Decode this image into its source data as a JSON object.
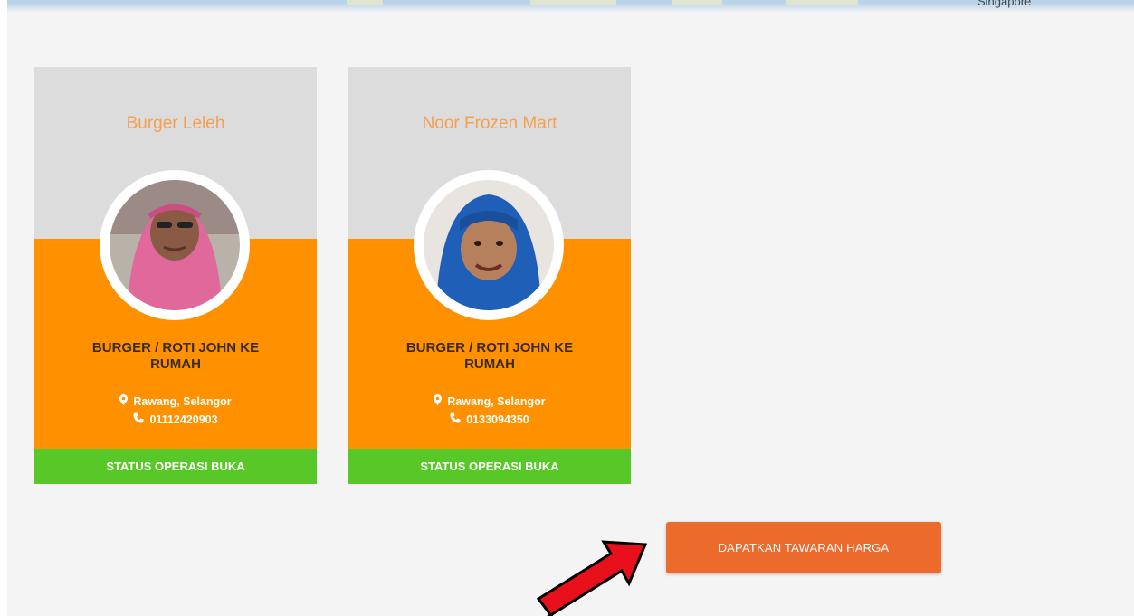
{
  "map": {
    "label": "Singapore"
  },
  "cards": [
    {
      "title": "Burger Leleh",
      "category": "BURGER / ROTI JOHN KE RUMAH",
      "location": "Rawang, Selangor",
      "phone": "01112420903",
      "status": "STATUS OPERASI BUKA",
      "avatar_colors": {
        "bg": "#b9b2a8",
        "hijab": "#e0689a",
        "skin": "#8a5a44"
      }
    },
    {
      "title": "Noor Frozen Mart",
      "category": "BURGER / ROTI JOHN KE RUMAH",
      "location": "Rawang, Selangor",
      "phone": "0133094350",
      "status": "STATUS OPERASI BUKA",
      "avatar_colors": {
        "bg": "#e8e4df",
        "hijab": "#1f5fb8",
        "skin": "#b7805c"
      }
    }
  ],
  "cta": {
    "label": "DAPATKAN TAWARAN HARGA"
  },
  "icons": {
    "location": "map-marker-icon",
    "phone": "phone-icon",
    "annotation": "red-arrow-icon"
  },
  "colors": {
    "card_orange": "#ff9000",
    "status_green": "#57c827",
    "title_orange": "#f6a04d",
    "cta_orange": "#ec6a2c",
    "arrow_red": "#e8101a"
  }
}
